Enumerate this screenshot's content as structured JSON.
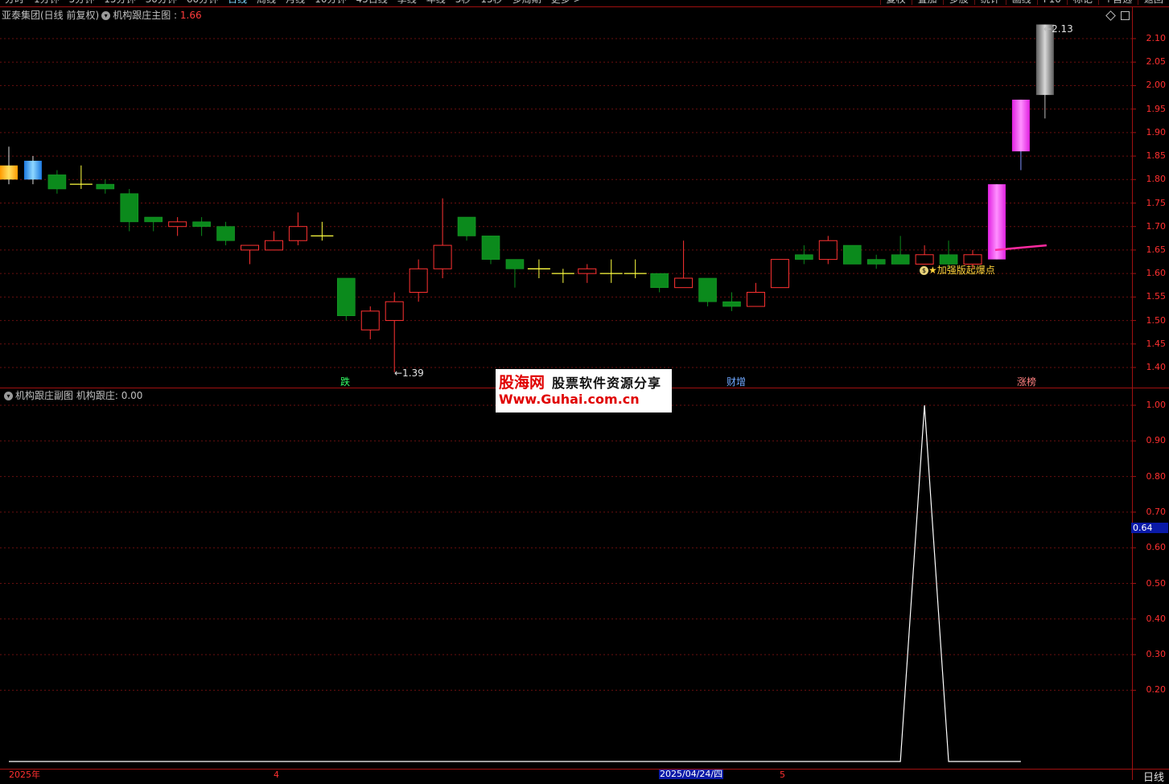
{
  "toolbar": {
    "tabs": [
      "分时",
      "1分钟",
      "5分钟",
      "15分钟",
      "30分钟",
      "60分钟",
      "日线",
      "周线",
      "月线",
      "10分钟",
      "45日线",
      "季线",
      "年线",
      "5秒",
      "15秒",
      "多周期",
      "更多 >"
    ],
    "active_index": 6,
    "right_buttons": [
      "复权",
      "叠加",
      "多股",
      "统计",
      "画线",
      "F10",
      "标记",
      "+自选",
      "返回"
    ]
  },
  "main_panel": {
    "stock_name": "亚泰集团(日线 前复权)",
    "indicator_name": "机构跟庄主图",
    "indicator_value": "1.66",
    "price_ticks": [
      "2.10",
      "2.05",
      "2.00",
      "1.95",
      "1.90",
      "1.85",
      "1.80",
      "1.75",
      "1.70",
      "1.65",
      "1.60",
      "1.55",
      "1.50",
      "1.45",
      "1.40"
    ],
    "high_label": "2.13",
    "low_label": "←1.39",
    "signal_text": "★加强版起爆点",
    "event_labels": [
      {
        "text": "跌",
        "color": "#33ff66"
      },
      {
        "text": "财增",
        "color": "#6fa8ff"
      },
      {
        "text": "涨榜",
        "color": "#ff8080"
      }
    ]
  },
  "sub_panel": {
    "indicator_name": "机构跟庄副图",
    "indicator_label": "机构跟庄:",
    "indicator_value": "0.00",
    "ticks": [
      "1.00",
      "0.90",
      "0.80",
      "0.70",
      "0.60",
      "0.50",
      "0.40",
      "0.30",
      "0.20"
    ],
    "cursor_value": "0.64"
  },
  "date_axis": {
    "labels": [
      "2025年",
      "4",
      "2025/04/24/四",
      "5"
    ],
    "period_label": "日线"
  },
  "watermark": {
    "brand": "股海网",
    "slogan": "股票软件资源分享",
    "url": "Www.Guhai.com.cn"
  },
  "chart_data": {
    "type": "candlestick",
    "price_range": [
      1.37,
      2.15
    ],
    "candles": [
      {
        "o": 1.8,
        "h": 1.87,
        "l": 1.79,
        "c": 1.83,
        "style": "gold"
      },
      {
        "o": 1.8,
        "h": 1.85,
        "l": 1.79,
        "c": 1.84,
        "style": "blue"
      },
      {
        "o": 1.81,
        "h": 1.82,
        "l": 1.77,
        "c": 1.78
      },
      {
        "o": 1.79,
        "h": 1.83,
        "l": 1.78,
        "c": 1.79
      },
      {
        "o": 1.79,
        "h": 1.8,
        "l": 1.77,
        "c": 1.78
      },
      {
        "o": 1.77,
        "h": 1.78,
        "l": 1.69,
        "c": 1.71
      },
      {
        "o": 1.72,
        "h": 1.72,
        "l": 1.69,
        "c": 1.71
      },
      {
        "o": 1.7,
        "h": 1.72,
        "l": 1.68,
        "c": 1.71
      },
      {
        "o": 1.71,
        "h": 1.72,
        "l": 1.68,
        "c": 1.7
      },
      {
        "o": 1.7,
        "h": 1.71,
        "l": 1.66,
        "c": 1.67
      },
      {
        "o": 1.65,
        "h": 1.66,
        "l": 1.62,
        "c": 1.66
      },
      {
        "o": 1.65,
        "h": 1.69,
        "l": 1.65,
        "c": 1.67
      },
      {
        "o": 1.67,
        "h": 1.73,
        "l": 1.66,
        "c": 1.7
      },
      {
        "o": 1.68,
        "h": 1.71,
        "l": 1.67,
        "c": 1.68
      },
      {
        "o": 1.59,
        "h": 1.59,
        "l": 1.5,
        "c": 1.51
      },
      {
        "o": 1.48,
        "h": 1.53,
        "l": 1.46,
        "c": 1.52
      },
      {
        "o": 1.5,
        "h": 1.56,
        "l": 1.39,
        "c": 1.54
      },
      {
        "o": 1.56,
        "h": 1.63,
        "l": 1.54,
        "c": 1.61
      },
      {
        "o": 1.61,
        "h": 1.76,
        "l": 1.59,
        "c": 1.66
      },
      {
        "o": 1.72,
        "h": 1.72,
        "l": 1.67,
        "c": 1.68
      },
      {
        "o": 1.68,
        "h": 1.68,
        "l": 1.62,
        "c": 1.63
      },
      {
        "o": 1.63,
        "h": 1.63,
        "l": 1.57,
        "c": 1.61
      },
      {
        "o": 1.61,
        "h": 1.63,
        "l": 1.59,
        "c": 1.61
      },
      {
        "o": 1.6,
        "h": 1.61,
        "l": 1.58,
        "c": 1.6
      },
      {
        "o": 1.6,
        "h": 1.62,
        "l": 1.58,
        "c": 1.61
      },
      {
        "o": 1.6,
        "h": 1.63,
        "l": 1.58,
        "c": 1.6
      },
      {
        "o": 1.6,
        "h": 1.63,
        "l": 1.59,
        "c": 1.6
      },
      {
        "o": 1.6,
        "h": 1.6,
        "l": 1.56,
        "c": 1.57
      },
      {
        "o": 1.57,
        "h": 1.67,
        "l": 1.57,
        "c": 1.59
      },
      {
        "o": 1.59,
        "h": 1.59,
        "l": 1.53,
        "c": 1.54
      },
      {
        "o": 1.54,
        "h": 1.56,
        "l": 1.52,
        "c": 1.53
      },
      {
        "o": 1.53,
        "h": 1.58,
        "l": 1.53,
        "c": 1.56
      },
      {
        "o": 1.57,
        "h": 1.63,
        "l": 1.57,
        "c": 1.63
      },
      {
        "o": 1.64,
        "h": 1.66,
        "l": 1.62,
        "c": 1.63
      },
      {
        "o": 1.63,
        "h": 1.68,
        "l": 1.62,
        "c": 1.67
      },
      {
        "o": 1.66,
        "h": 1.66,
        "l": 1.62,
        "c": 1.62
      },
      {
        "o": 1.63,
        "h": 1.64,
        "l": 1.61,
        "c": 1.62
      },
      {
        "o": 1.64,
        "h": 1.68,
        "l": 1.62,
        "c": 1.62
      },
      {
        "o": 1.62,
        "h": 1.66,
        "l": 1.62,
        "c": 1.64
      },
      {
        "o": 1.64,
        "h": 1.67,
        "l": 1.61,
        "c": 1.62
      },
      {
        "o": 1.62,
        "h": 1.65,
        "l": 1.61,
        "c": 1.64
      },
      {
        "o": 1.63,
        "h": 1.79,
        "l": 1.63,
        "c": 1.79,
        "style": "magenta"
      },
      {
        "o": 1.86,
        "h": 1.97,
        "l": 1.82,
        "c": 1.97,
        "style": "magenta"
      },
      {
        "o": 1.98,
        "h": 2.13,
        "l": 1.93,
        "c": 2.13,
        "style": "gray"
      }
    ],
    "signal_line": [
      1.65,
      1.66
    ],
    "sub_indicator": {
      "range": [
        0,
        1.0
      ],
      "values": [
        0,
        0,
        0,
        0,
        0,
        0,
        0,
        0,
        0,
        0,
        0,
        0,
        0,
        0,
        0,
        0,
        0,
        0,
        0,
        0,
        0,
        0,
        0,
        0,
        0,
        0,
        0,
        0,
        0,
        0,
        0,
        0,
        0,
        0,
        0,
        0,
        0,
        0,
        1,
        0,
        0,
        0,
        0
      ]
    }
  }
}
